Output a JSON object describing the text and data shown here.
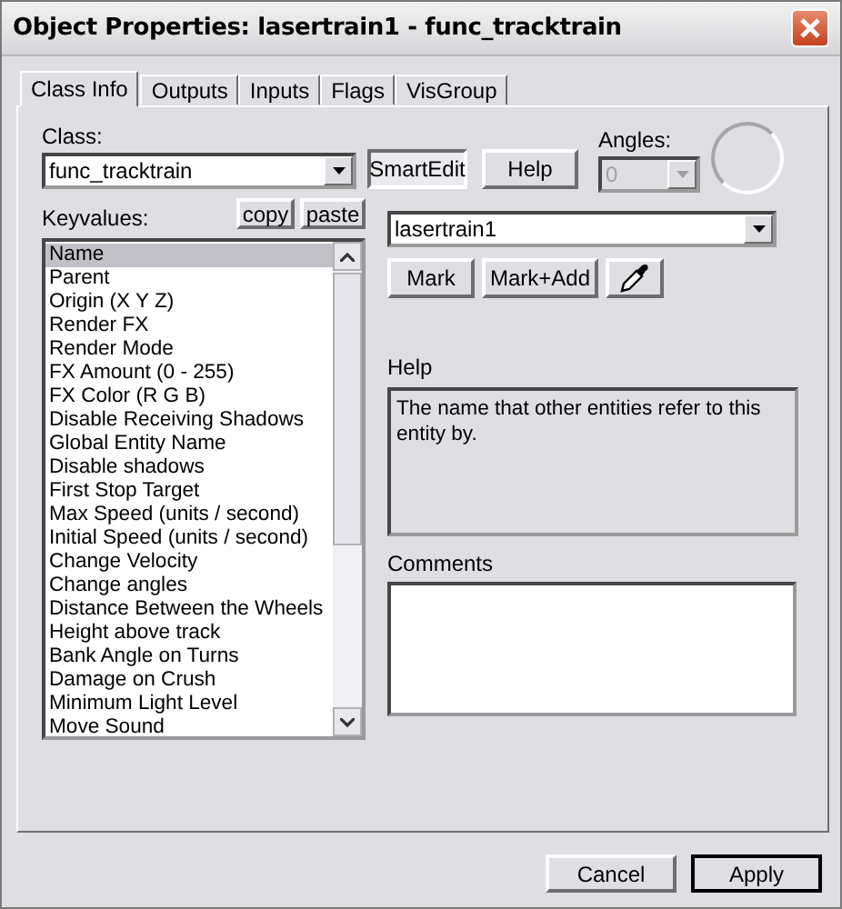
{
  "window": {
    "title": "Object Properties: lasertrain1 - func_tracktrain"
  },
  "tabs": [
    {
      "label": "Class Info",
      "selected": true
    },
    {
      "label": "Outputs",
      "selected": false
    },
    {
      "label": "Inputs",
      "selected": false
    },
    {
      "label": "Flags",
      "selected": false
    },
    {
      "label": "VisGroup",
      "selected": false
    }
  ],
  "class": {
    "label": "Class:",
    "value": "func_tracktrain"
  },
  "smart_edit": {
    "label": "SmartEdit",
    "pressed": true
  },
  "help_button": {
    "label": "Help"
  },
  "angles": {
    "label": "Angles:",
    "value": "0",
    "disabled": true
  },
  "keyvalues": {
    "label": "Keyvalues:",
    "copy": "copy",
    "paste": "paste",
    "items": [
      {
        "label": "Name",
        "selected": true
      },
      {
        "label": "Parent",
        "selected": false
      },
      {
        "label": "Origin (X Y Z)",
        "selected": false
      },
      {
        "label": "Render FX",
        "selected": false
      },
      {
        "label": "Render Mode",
        "selected": false
      },
      {
        "label": "FX Amount (0 - 255)",
        "selected": false
      },
      {
        "label": "FX Color (R G B)",
        "selected": false
      },
      {
        "label": "Disable Receiving Shadows",
        "selected": false
      },
      {
        "label": "Global Entity Name",
        "selected": false
      },
      {
        "label": "Disable shadows",
        "selected": false
      },
      {
        "label": "First Stop Target",
        "selected": false
      },
      {
        "label": "Max Speed (units / second)",
        "selected": false
      },
      {
        "label": "Initial Speed (units / second)",
        "selected": false
      },
      {
        "label": "Change Velocity",
        "selected": false
      },
      {
        "label": "Change angles",
        "selected": false
      },
      {
        "label": "Distance Between the Wheels",
        "selected": false
      },
      {
        "label": "Height above track",
        "selected": false
      },
      {
        "label": "Bank Angle on Turns",
        "selected": false
      },
      {
        "label": "Damage on Crush",
        "selected": false
      },
      {
        "label": "Minimum Light Level",
        "selected": false
      },
      {
        "label": "Move Sound",
        "selected": false
      }
    ]
  },
  "value": {
    "value": "lasertrain1",
    "buttons": [
      "Mark",
      "Mark+Add"
    ]
  },
  "help": {
    "label": "Help",
    "text": "The name that other entities refer to this entity by."
  },
  "comments": {
    "label": "Comments"
  },
  "footer": [
    {
      "label": "Cancel",
      "default": false
    },
    {
      "label": "Apply",
      "default": true
    }
  ]
}
